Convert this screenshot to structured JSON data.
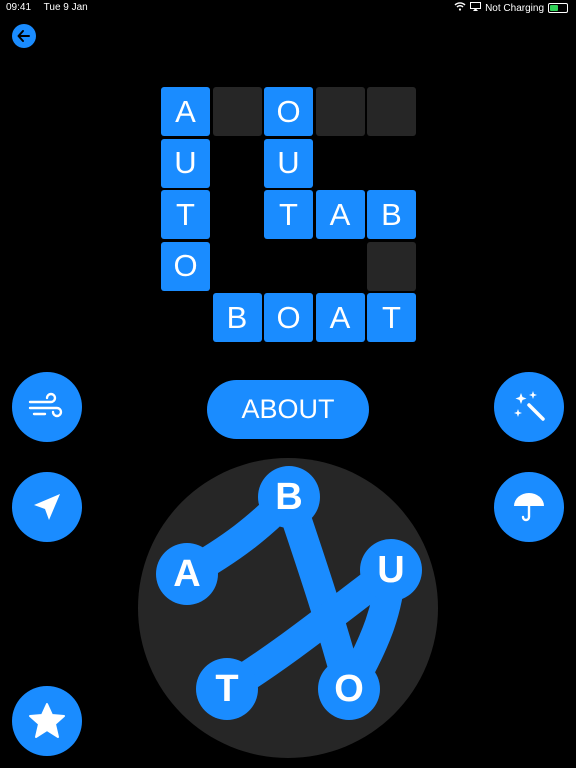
{
  "status_bar": {
    "time": "09:41",
    "date": "Tue 9 Jan",
    "charging": "Not Charging"
  },
  "colors": {
    "accent": "#1a8cff",
    "background": "#000000",
    "empty_cell": "#262626",
    "wheel": "#262626"
  },
  "grid": {
    "rows": [
      [
        "A",
        "#",
        "O",
        "#",
        "#"
      ],
      [
        "U",
        "",
        "U",
        "",
        ""
      ],
      [
        "T",
        "",
        "T",
        "A",
        "B"
      ],
      [
        "O",
        "",
        "",
        "",
        "#"
      ],
      [
        "",
        "B",
        "O",
        "A",
        "T"
      ]
    ]
  },
  "current_word": "ABOUT",
  "wheel_letters": [
    "B",
    "A",
    "U",
    "T",
    "O"
  ],
  "buttons": {
    "left": [
      "wind-icon",
      "paper-plane-icon",
      "star-icon"
    ],
    "right": [
      "magic-wand-icon",
      "umbrella-icon"
    ]
  }
}
